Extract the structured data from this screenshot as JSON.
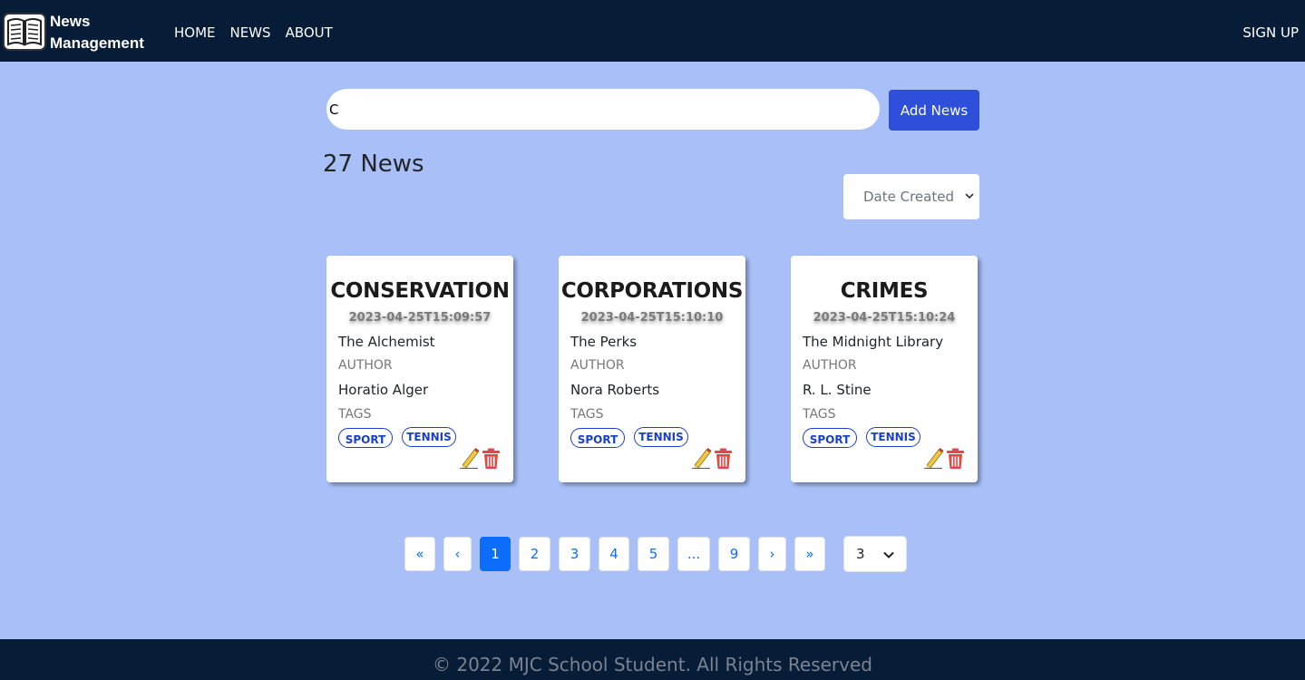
{
  "header": {
    "brand_line1": "News",
    "brand_line2": "Management",
    "nav": [
      "HOME",
      "NEWS",
      "ABOUT"
    ],
    "signup": "SIGN UP",
    "logo_icon": "open-book-icon"
  },
  "search": {
    "value": "C",
    "add_button": "Add News"
  },
  "news_count": "27 News",
  "sort": {
    "selected": "Date Created"
  },
  "cards": [
    {
      "title": "CONSERVATION",
      "date": "2023-04-25T15:09:57",
      "name": "The Alchemist",
      "author_label": "AUTHOR",
      "author": "Horatio Alger",
      "tags_label": "TAGS",
      "tags": [
        "SPORT",
        "TENNIS"
      ]
    },
    {
      "title": "CORPORATIONS",
      "date": "2023-04-25T15:10:10",
      "name": "The Perks",
      "author_label": "AUTHOR",
      "author": "Nora Roberts",
      "tags_label": "TAGS",
      "tags": [
        "SPORT",
        "TENNIS"
      ]
    },
    {
      "title": "CRIMES",
      "date": "2023-04-25T15:10:24",
      "name": "The Midnight Library",
      "author_label": "AUTHOR",
      "author": "R. L. Stine",
      "tags_label": "TAGS",
      "tags": [
        "SPORT",
        "TENNIS"
      ]
    }
  ],
  "pagination": {
    "pages": [
      "«",
      "‹",
      "1",
      "2",
      "3",
      "4",
      "5",
      "...",
      "9",
      "›",
      "»"
    ],
    "active": "1",
    "page_size": "3"
  },
  "footer": {
    "text": "© 2022 MJC School Student. All Rights Reserved"
  },
  "colors": {
    "navbar": "#071c37",
    "background": "#a9bff7",
    "add_button": "#2d4fd9",
    "active_page": "#0d6efd",
    "tag": "#1a3fd0",
    "delete": "#e04848"
  }
}
